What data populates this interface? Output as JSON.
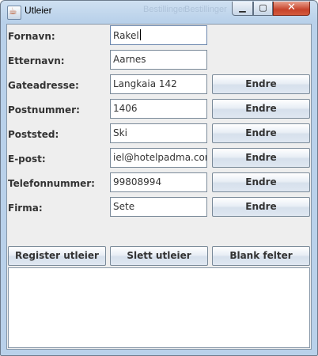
{
  "window": {
    "title": "Utleier",
    "ghost_titles": [
      "Bestillinger",
      "Bestillinger"
    ]
  },
  "titlebar_buttons": {
    "minimize": "▁",
    "maximize": "▢",
    "close": "✕"
  },
  "fields": [
    {
      "label": "Fornavn:",
      "value": "Rakel",
      "has_button": false
    },
    {
      "label": "Etternavn:",
      "value": "Aarnes",
      "has_button": false
    },
    {
      "label": "Gateadresse:",
      "value": "Langkaia 142",
      "has_button": true
    },
    {
      "label": "Postnummer:",
      "value": "1406",
      "has_button": true
    },
    {
      "label": "Poststed:",
      "value": "Ski",
      "has_button": true
    },
    {
      "label": "E-post:",
      "value": "iel@hotelpadma.com",
      "has_button": true
    },
    {
      "label": "Telefonnummer:",
      "value": "99808994",
      "has_button": true
    },
    {
      "label": "Firma:",
      "value": "Sete",
      "has_button": true
    }
  ],
  "edit_button_label": "Endre",
  "actions": {
    "register": "Register utleier",
    "delete": "Slett utleier",
    "clear": "Blank felter"
  },
  "output_area": ""
}
